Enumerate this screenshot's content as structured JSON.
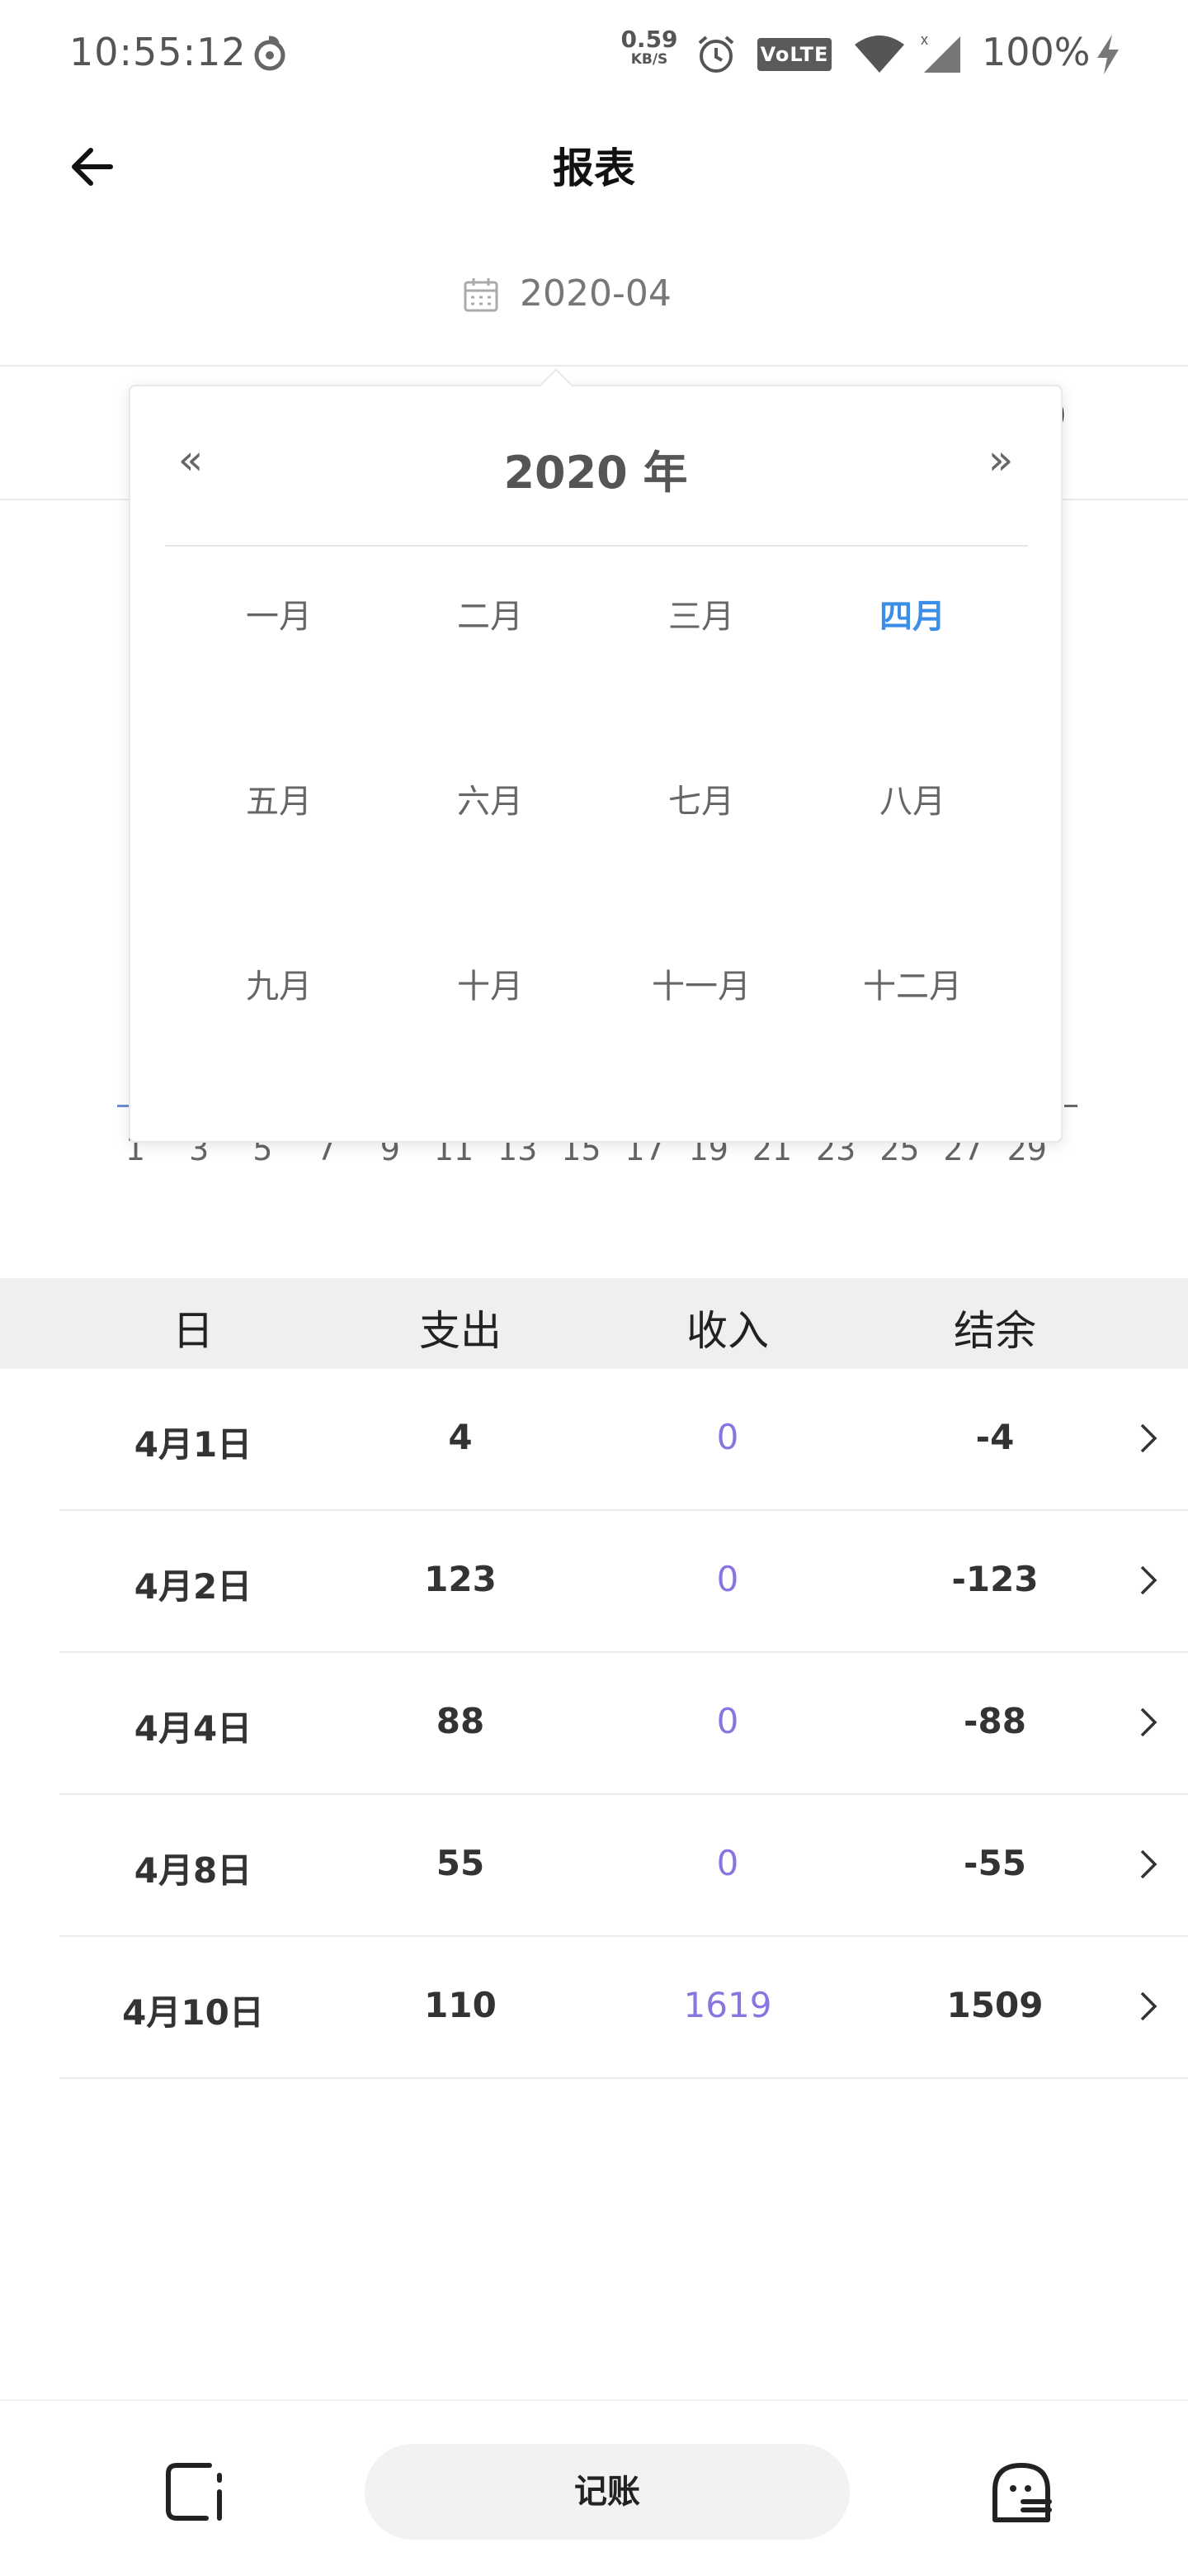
{
  "status_bar": {
    "time": "10:55:12",
    "net_speed_value": "0.59",
    "net_speed_unit": "KB/S",
    "volte": "VoLTE",
    "battery": "100%"
  },
  "header": {
    "title": "报表"
  },
  "date_selector": {
    "value": "2020-04"
  },
  "summary_peek": "0",
  "month_picker": {
    "prev": "«",
    "next": "»",
    "year": "2020 年",
    "months": [
      "一月",
      "二月",
      "三月",
      "四月",
      "五月",
      "六月",
      "七月",
      "八月",
      "九月",
      "十月",
      "十一月",
      "十二月"
    ],
    "selected": "四月"
  },
  "chart_x_ticks": [
    "1",
    "3",
    "5",
    "7",
    "9",
    "11",
    "13",
    "15",
    "17",
    "19",
    "21",
    "23",
    "25",
    "27",
    "29"
  ],
  "table": {
    "headers": [
      "日",
      "支出",
      "收入",
      "结余"
    ],
    "rows": [
      {
        "day": "4月1日",
        "expense": "4",
        "income": "0",
        "balance": "-4"
      },
      {
        "day": "4月2日",
        "expense": "123",
        "income": "0",
        "balance": "-123"
      },
      {
        "day": "4月4日",
        "expense": "88",
        "income": "0",
        "balance": "-88"
      },
      {
        "day": "4月8日",
        "expense": "55",
        "income": "0",
        "balance": "-55"
      },
      {
        "day": "4月10日",
        "expense": "110",
        "income": "1619",
        "balance": "1509"
      }
    ]
  },
  "bottom_bar": {
    "record_label": "记账"
  },
  "colors": {
    "accent": "#3a8ee6",
    "income": "#8b74e0",
    "header_bg": "#efefef"
  }
}
